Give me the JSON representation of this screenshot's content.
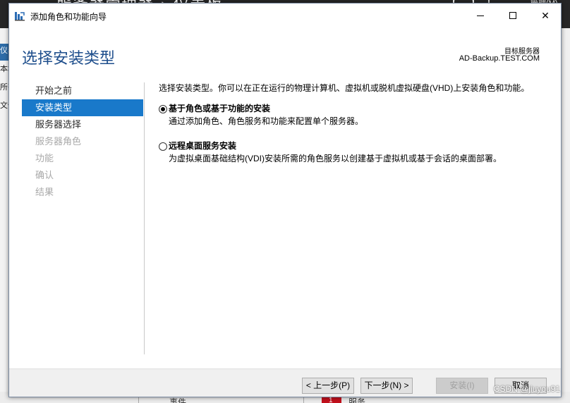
{
  "background": {
    "heading_left": "服务器管理器",
    "heading_right": "仪表板",
    "manage_menu": "管理(M)",
    "left_panel_items": [
      "仪表",
      "本地",
      "所有",
      "文件"
    ],
    "bottom_left_text": "事件",
    "bottom_badge": "1",
    "bottom_right_text": "服务"
  },
  "dialog": {
    "title": "添加角色和功能向导",
    "window_controls": {
      "minimize_icon": "minimize-icon",
      "maximize_icon": "maximize-icon",
      "close_icon": "close-icon",
      "close_glyph": "✕"
    },
    "header": {
      "page_title": "选择安装类型",
      "target_label": "目标服务器",
      "target_value": "AD-Backup.TEST.COM"
    },
    "steps": [
      {
        "label": "开始之前",
        "state": "done"
      },
      {
        "label": "安装类型",
        "state": "current"
      },
      {
        "label": "服务器选择",
        "state": "available"
      },
      {
        "label": "服务器角色",
        "state": "disabled"
      },
      {
        "label": "功能",
        "state": "disabled"
      },
      {
        "label": "确认",
        "state": "disabled"
      },
      {
        "label": "结果",
        "state": "disabled"
      }
    ],
    "content": {
      "intro": "选择安装类型。你可以在正在运行的物理计算机、虚拟机或脱机虚拟硬盘(VHD)上安装角色和功能。",
      "options": [
        {
          "title": "基于角色或基于功能的安装",
          "description": "通过添加角色、角色服务和功能来配置单个服务器。",
          "selected": true
        },
        {
          "title": "远程桌面服务安装",
          "description": "为虚拟桌面基础结构(VDI)安装所需的角色服务以创建基于虚拟机或基于会话的桌面部署。",
          "selected": false
        }
      ]
    },
    "footer": {
      "prev": "< 上一步(P)",
      "next": "下一步(N) >",
      "install": "安装(I)",
      "cancel": "取消"
    }
  },
  "watermark": "CSDN @jiuyou91",
  "colors": {
    "accent": "#1979ca",
    "heading": "#1e4e8c",
    "disabled_text": "#a9a9a9"
  }
}
